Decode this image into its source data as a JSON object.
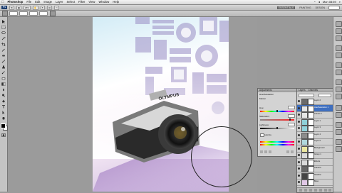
{
  "menubar": {
    "apple_icon": "apple-logo",
    "app_name": "Photoshop",
    "items": [
      "File",
      "Edit",
      "Image",
      "Layer",
      "Select",
      "Filter",
      "View",
      "Window",
      "Help"
    ],
    "clock": "Mon 08:59"
  },
  "appbar": {
    "badge": "Ps",
    "zoom_value": "25%",
    "workspaces": [
      "ESSENTIALS",
      "PAINTING",
      "DESIGN"
    ],
    "active_workspace": "ESSENTIALS"
  },
  "adjustments_panel": {
    "header": "Adjustments",
    "preset_label": "Hue/Saturation",
    "channel": "Master",
    "rows": [
      "Hue:",
      "Saturation:",
      "Lightness:"
    ],
    "colorize_label": "Colorize",
    "hue_level": 0.5,
    "saturation_level": 0.88,
    "lightness_level": 0.5
  },
  "layers_panel": {
    "tabs": [
      "Layers",
      "Channels"
    ],
    "selected_layer": "Hue/Saturation 1",
    "layers": [
      {
        "name": "Layer 2",
        "thumb": "#6a6a6a"
      },
      {
        "name": "Hue/Saturation 1",
        "thumb": "#e6e6e6"
      },
      {
        "name": "Curves 1",
        "thumb": "#e6e6e6"
      },
      {
        "name": "Layer 1",
        "thumb": "#8fd0d8"
      },
      {
        "name": "Layer 3",
        "thumb": "#91d3dc"
      },
      {
        "name": "Layer 4",
        "thumb": "#8c8c8c"
      },
      {
        "name": "Layer 5",
        "thumb": "#b0d7dd"
      },
      {
        "name": "Background",
        "thumb": "#ece7a0"
      },
      {
        "name": "Group 1",
        "thumb": "#d9d9d9"
      },
      {
        "name": "Effects",
        "thumb": "#d9d9d9"
      },
      {
        "name": "Camera",
        "thumb": "#666666"
      },
      {
        "name": "Shadow",
        "thumb": "#444444"
      },
      {
        "name": "Base",
        "thumb": "#e0c8e6"
      }
    ]
  },
  "document": {
    "camera_brand": "OLYMPUS"
  },
  "colors": {
    "foreground": "#000000",
    "background": "#ffffff",
    "selection": "#3f6fbf"
  }
}
